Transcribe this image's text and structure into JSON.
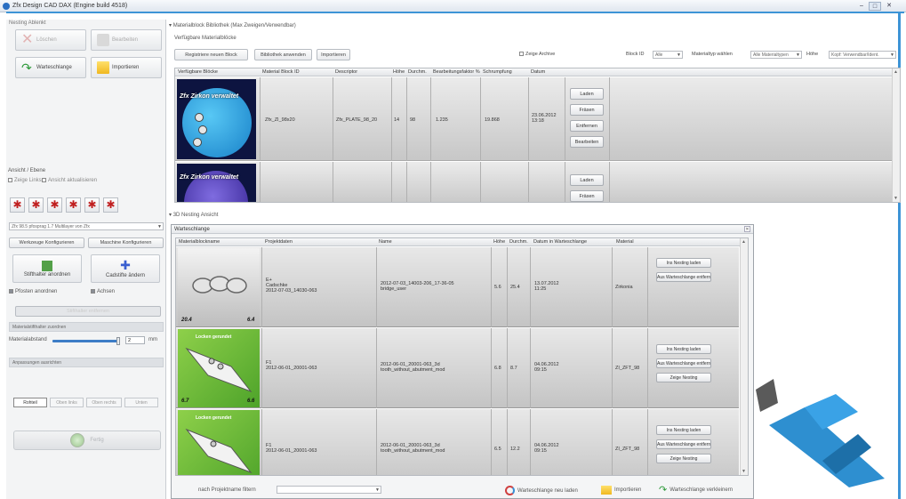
{
  "window": {
    "title": "Zfx Design CAD DAX (Engine build 4518)",
    "controls": [
      "–",
      "□",
      "✕"
    ]
  },
  "left_panel": {
    "header": "Nesting Ablenkt",
    "btn_loeschen": "Löschen",
    "btn_bearbeiten": "Bearbeiten",
    "btn_warteschlange": "Warteschlange",
    "btn_importieren": "Importieren",
    "view_label": "Ansicht / Ebene",
    "cb_zeige_links": "Zeige Links",
    "cb_ansicht_aktualisieren": "Ansicht aktualisieren",
    "view_icons": [
      "✱",
      "✱",
      "✱",
      "✱",
      "✱",
      "✱"
    ],
    "dropdown_text": "Zfx 98.5 pfosprag 1.7 Multilayer von Zfx",
    "btn_werkzeuge": "Werkzeuge Konfigurieren",
    "btn_maschine": "Maschine Konfigurieren",
    "btn_stifthalter": "Stifthalter anordnen",
    "btn_cadstifte": "Cadstifte ändern",
    "cb_pfosten": "Pfosten anordnen",
    "cb_achsen": "Achsen",
    "section_leer": "Stifthalter entfernen",
    "section_material": "Materialstifthalter zuordnen",
    "material_abstand_label": "Materialabstand",
    "material_abstand_value": "2",
    "material_abstand_unit": "mm",
    "section_ausrichten": "Anpassungen ausrichten",
    "segments": [
      "Rohteil",
      "Oben links",
      "Oben rechts",
      "Unten"
    ],
    "btn_ok": "Fertig"
  },
  "library": {
    "header": "Materialblock Bibliothek (Max Zweigen/Verwendbar)",
    "subheader": "Verfügbare Materialblöcke",
    "toolbar": {
      "btn_new": "Registriere neuen Block",
      "btn_lib": "Bibliothek anwenden",
      "btn_import": "Importieren",
      "cb_archive": "Zeige Archive",
      "block_id_label": "Block ID",
      "block_id_value": "Alle",
      "material_label": "Materialtyp wählen",
      "material_value": "Alle Materialtypen",
      "height_label": "Höhe",
      "height_value": "Kopf: Verwendbar/Ident."
    },
    "columns": [
      "Verfügbare Blöcke",
      "Material Block ID",
      "Descriptor",
      "Höhe",
      "Durchm.",
      "Bearbeitungsfaktor %",
      "Schrumpfung",
      "Datum"
    ],
    "rows": [
      {
        "thumb_label": "Zfx Zirkon verwaltet",
        "id": "Zfx_ZI_98x20",
        "desc": "Zfx_PLATE_98_20",
        "height": "14",
        "diameter": "98",
        "factor": "1.235",
        "shrink": "19.868",
        "date": "23.06.2012 13:18",
        "actions": [
          "Laden",
          "Fräsen",
          "Entfernen",
          "Bearbeiten"
        ]
      },
      {
        "thumb_label": "Zfx Zirkon verwaltet",
        "id": "",
        "desc": "",
        "height": "",
        "diameter": "",
        "factor": "",
        "shrink": "",
        "date": "",
        "actions": [
          "Laden",
          "Fräsen"
        ]
      }
    ]
  },
  "nesting_section": "3D Nesting Ansicht",
  "queue": {
    "title": "Warteschlange",
    "columns": [
      "Materialblockname",
      "Projektdaten",
      "Name",
      "Höhe",
      "Durchm.",
      "Datum in Warteschlange",
      "Material"
    ],
    "rows": [
      {
        "thumb": "grey",
        "val_left": "20.4",
        "val_right": "6.4",
        "tag": "",
        "project": "E+\nCadschke\n2012-07-03_14030-063",
        "name": "2012-07-03_14003-206_17-36-05\nbridge_user",
        "height": "5.6",
        "diameter": "25.4",
        "date": "13.07.2012\n11:25",
        "material": "Zirkonia",
        "actions": [
          "Ins Nesting laden",
          "Aus Warteschlange entfernen"
        ]
      },
      {
        "thumb": "green",
        "val_left": "6.7",
        "val_right": "6.6",
        "tag": "Locken gerundet",
        "project": "F1\n2012-06-01_20001-063",
        "name": "2012-06-01_20001-063_3d\ntooth_without_abutment_mod",
        "height": "6.8",
        "diameter": "8.7",
        "date": "04.06.2012\n09:15",
        "material": "ZI_ZFT_98",
        "actions": [
          "Ins Nesting laden",
          "Aus Warteschlange entfernen",
          "Zeige Nesting"
        ]
      },
      {
        "thumb": "green",
        "val_left": "",
        "val_right": "",
        "tag": "Locken gerundet",
        "project": "F1\n2012-06-01_20001-063",
        "name": "2012-06-01_20001-063_3d\ntooth_without_abutment_mod",
        "height": "6.5",
        "diameter": "12.2",
        "date": "04.06.2012\n09:15",
        "material": "ZI_ZFT_98",
        "actions": [
          "Ins Nesting laden",
          "Aus Warteschlange entfernen",
          "Zeige Nesting"
        ]
      }
    ],
    "footer": {
      "filter_label": "nach Projektname filtern",
      "btn_reload": "Warteschlange neu laden",
      "btn_import": "Importieren",
      "btn_collapse": "Warteschlange verkleinern"
    }
  },
  "colors": {
    "accent_blue": "#3d94d6",
    "thumb_green": "#6cbc3a",
    "row_grey": "#c7c7c7"
  }
}
